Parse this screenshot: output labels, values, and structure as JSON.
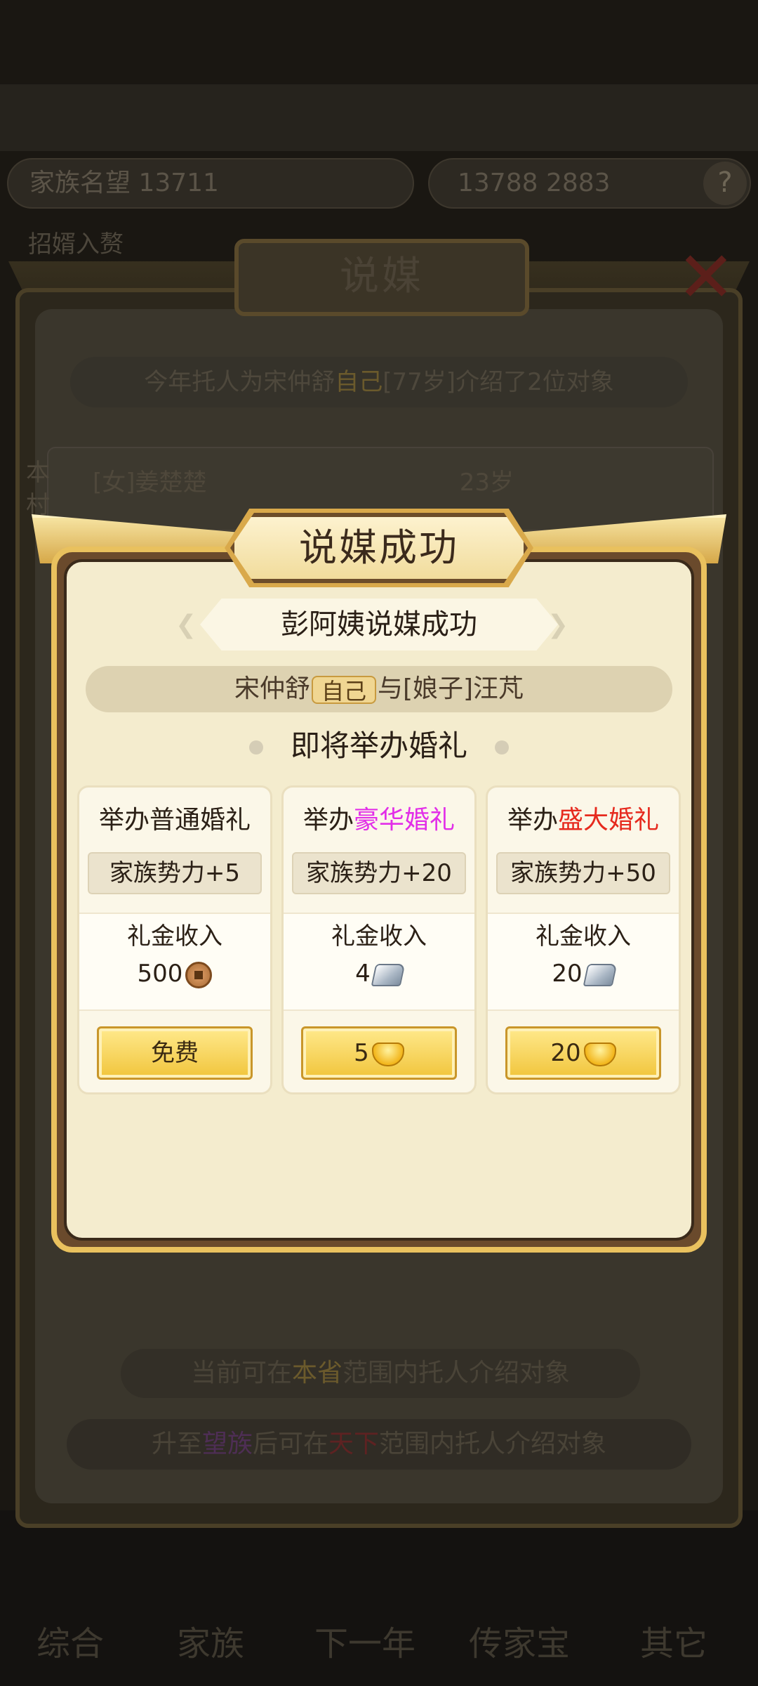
{
  "background": {
    "resource_left": "家族名望 13711",
    "resource_right": "13788 2883",
    "help_symbol": "?",
    "subheader": "招婿入赘",
    "bottom_nav": [
      "综合",
      "家族",
      "下一年",
      "传家宝",
      "其它"
    ]
  },
  "matchmaking_dialog": {
    "title": "说媒",
    "info": {
      "before": "今年托人为宋仲舒",
      "self_badge": "自己",
      "after": "[77岁]介绍了2位对象"
    },
    "candidate": {
      "tag": "本村",
      "name": "[女]姜楚楚",
      "age": "23岁"
    },
    "footer1": {
      "before": "当前可在",
      "highlight": "本省",
      "after": "范围内托人介绍对象"
    },
    "footer2": {
      "before": "升至",
      "highlight1": "望族",
      "middle": "后可在",
      "highlight2": "天下",
      "after": "范围内托人介绍对象"
    }
  },
  "success_dialog": {
    "title": "说媒成功",
    "banner": "彭阿姨说媒成功",
    "couple": {
      "groom": "宋仲舒",
      "self_badge": "自己",
      "connector": "与[娘子]汪芃"
    },
    "subtitle": "即将举办婚礼",
    "income_label": "礼金收入",
    "options": [
      {
        "title_prefix": "举办",
        "title_highlight": "",
        "title_plain": "普通婚礼",
        "power": "家族势力+5",
        "income": "500",
        "income_icon": "copper-coin-icon",
        "cost_label": "免费",
        "cost_icon": ""
      },
      {
        "title_prefix": "举办",
        "title_highlight": "豪华婚礼",
        "title_plain": "",
        "highlight_color": "#e22ee8",
        "power": "家族势力+20",
        "income": "4",
        "income_icon": "silver-ingot-icon",
        "cost_label": "5",
        "cost_icon": "gold-ingot-icon"
      },
      {
        "title_prefix": "举办",
        "title_highlight": "盛大婚礼",
        "title_plain": "",
        "highlight_color": "#e62a1e",
        "power": "家族势力+50",
        "income": "20",
        "income_icon": "silver-ingot-icon",
        "cost_label": "20",
        "cost_icon": "gold-ingot-icon"
      }
    ]
  }
}
